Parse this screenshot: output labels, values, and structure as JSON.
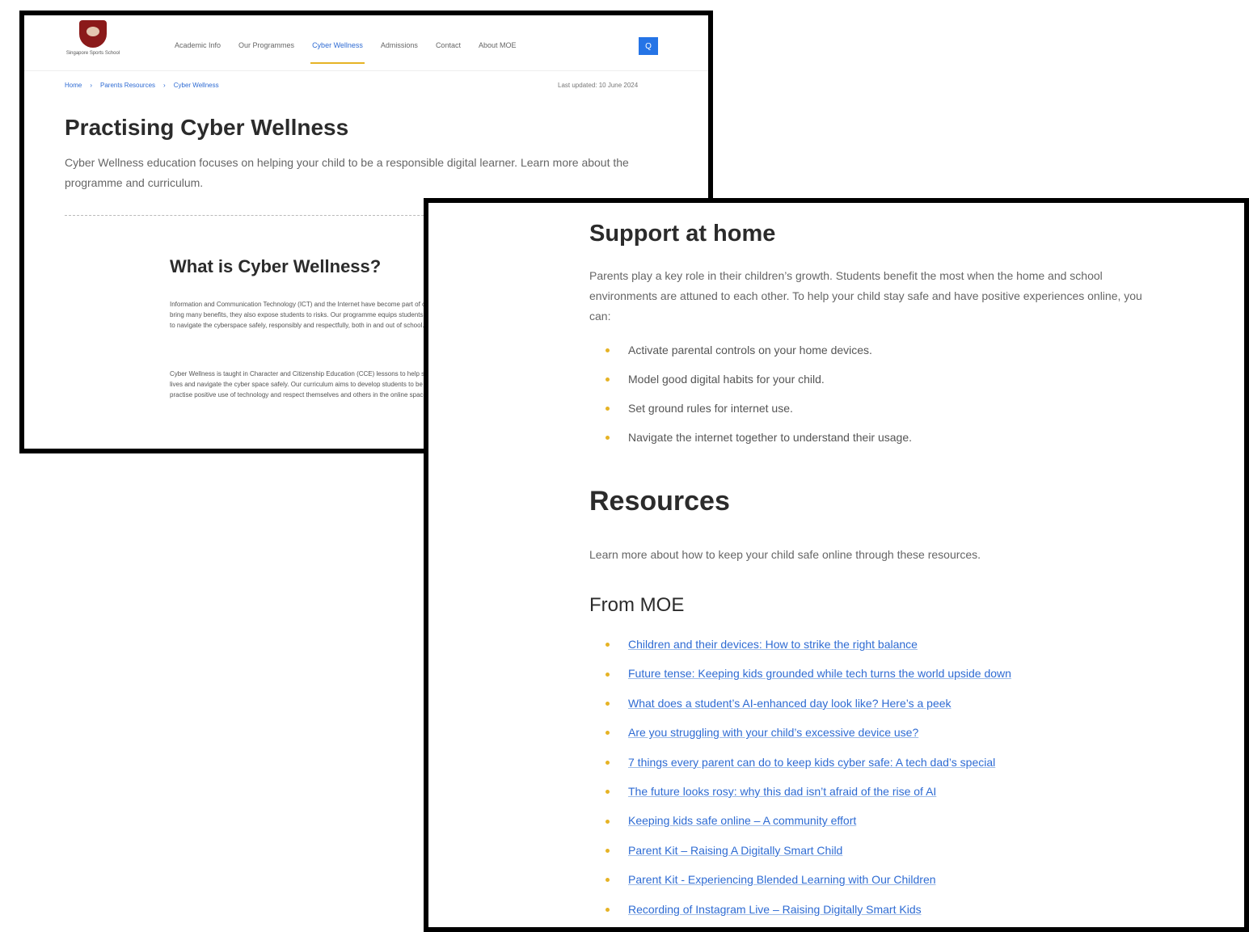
{
  "header": {
    "logo_text": "Singapore Sports School",
    "nav": [
      "Academic Info",
      "Our Programmes",
      "Cyber Wellness",
      "Admissions",
      "Contact",
      "About MOE"
    ],
    "search_label": "Q"
  },
  "breadcrumb": [
    "Home",
    "Parents Resources",
    "Cyber Wellness"
  ],
  "last_updated": "Last updated: 10 June 2024",
  "page_title": "Practising Cyber Wellness",
  "intro": "Cyber Wellness education focuses on helping your child to be a responsible digital learner. Learn more about the programme and curriculum.",
  "what": {
    "title": "What is Cyber Wellness?",
    "p1": "Information and Communication Technology (ICT) and the Internet have become part of our daily lives. While they bring many benefits, they also expose students to risks. Our programme equips students with the knowledge and skills to navigate the cyberspace safely, responsibly and respectfully, both in and out of school.",
    "p2": "Cyber Wellness is taught in Character and Citizenship Education (CCE) lessons to help students manage their digital lives and navigate the cyber space safely. Our curriculum aims to develop students to be responsible users of ICT who practise positive use of technology and respect themselves and others in the online space."
  },
  "support": {
    "title": "Support at home",
    "para": "Parents play a key role in their children’s growth. Students benefit the most when the home and school environments are attuned to each other. To help your child stay safe and have positive experiences online, you can:",
    "tips": [
      "Activate parental controls on your home devices.",
      "Model good digital habits for your child.",
      "Set ground rules for internet use.",
      "Navigate the internet together to understand their usage."
    ]
  },
  "resources": {
    "title": "Resources",
    "para": "Learn more about how to keep your child safe online through these resources.",
    "moe_title": "From MOE",
    "links": [
      "Children and their devices: How to strike the right balance",
      "Future tense: Keeping kids grounded while tech turns the world upside down",
      "What does a student’s AI-enhanced day look like? Here’s a peek",
      "Are you struggling with your child’s excessive device use?",
      "7 things every parent can do to keep kids cyber safe: A tech dad’s special",
      "The future looks rosy: why this dad isn’t afraid of the rise of AI",
      "Keeping kids safe online – A community effort",
      "Parent Kit – Raising A Digitally Smart Child",
      "Parent Kit - Experiencing Blended Learning with Our Children",
      "Recording of Instagram Live – Raising Digitally Smart Kids"
    ]
  }
}
